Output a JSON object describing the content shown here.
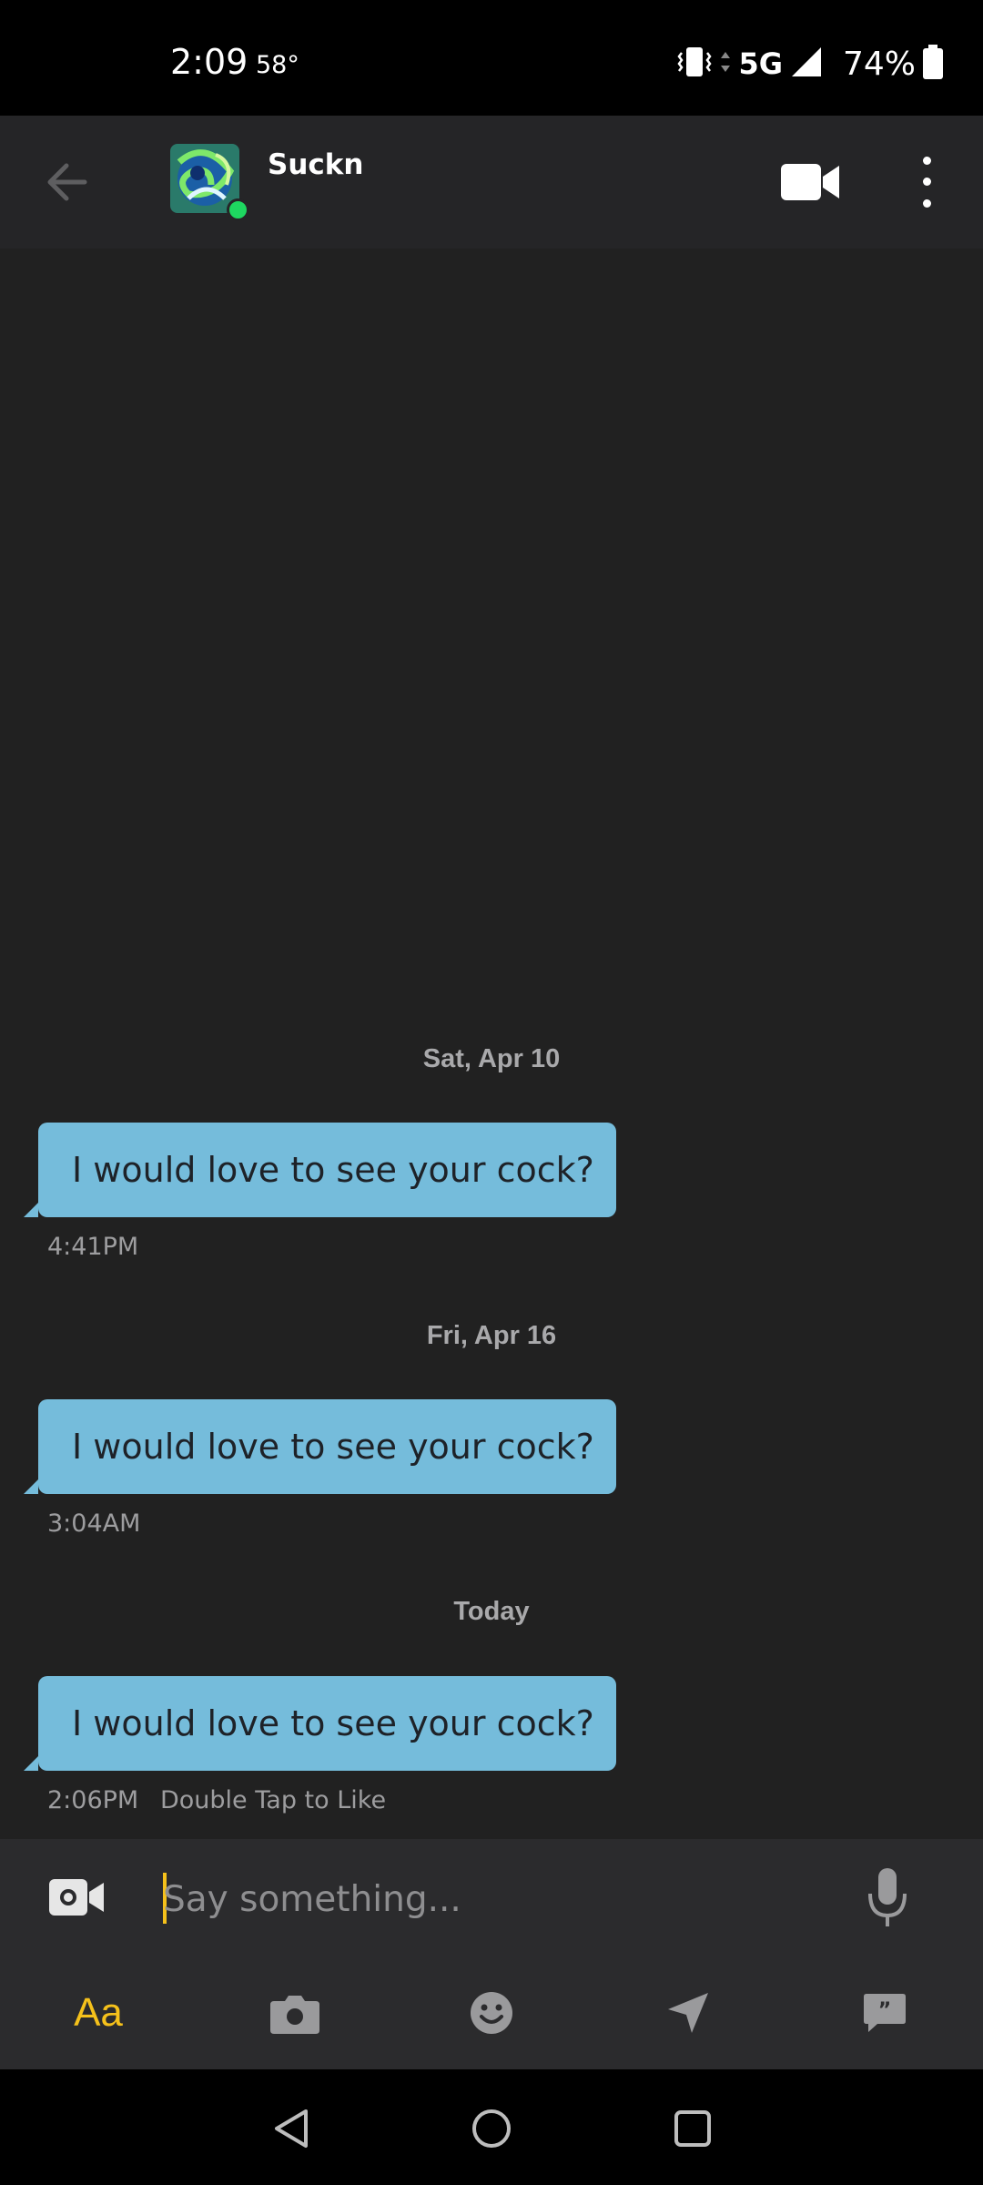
{
  "status_bar": {
    "time": "2:09",
    "temperature": "58°",
    "network": "5G",
    "battery": "74%"
  },
  "header": {
    "contact_name": "Suckn",
    "online": true
  },
  "conversation": [
    {
      "date": "Sat, Apr 10",
      "message": "I would love to see your cock?",
      "time": "4:41PM",
      "hint": ""
    },
    {
      "date": "Fri, Apr 16",
      "message": "I would love to see your cock?",
      "time": "3:04AM",
      "hint": ""
    },
    {
      "date": "Today",
      "message": "I would love to see your cock?",
      "time": "2:06PM",
      "hint": "Double Tap to Like"
    }
  ],
  "composer": {
    "placeholder": "Say something..."
  },
  "toolbar": {
    "text_style_label": "Aa",
    "icons": [
      "text-style-icon",
      "camera-icon",
      "emoji-icon",
      "location-icon",
      "saved-phrases-icon"
    ]
  },
  "colors": {
    "accent": "#f5c11b",
    "bubble": "#75bcdb",
    "online": "#1ed760",
    "background": "#212121"
  }
}
